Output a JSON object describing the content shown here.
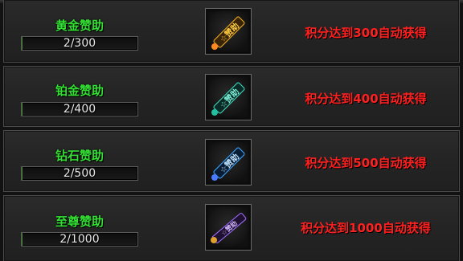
{
  "sponsor_tiers": [
    {
      "name": "黄金赞助",
      "progress_text": "2/300",
      "progress_fraction": 0.0067,
      "condition": "积分达到300自动获得",
      "badge_icon": "gold-title-badge-icon",
      "badge_color": "#f0b020"
    },
    {
      "name": "铂金赞助",
      "progress_text": "2/400",
      "progress_fraction": 0.005,
      "condition": "积分达到400自动获得",
      "badge_icon": "platinum-title-badge-icon",
      "badge_color": "#40e0c0"
    },
    {
      "name": "钻石赞助",
      "progress_text": "2/500",
      "progress_fraction": 0.004,
      "condition": "积分达到500自动获得",
      "badge_icon": "diamond-title-badge-icon",
      "badge_color": "#40a8ff"
    },
    {
      "name": "至尊赞助",
      "progress_text": "2/1000",
      "progress_fraction": 0.002,
      "condition": "积分达到1000自动获得",
      "badge_icon": "supreme-title-badge-icon",
      "badge_color": "#a070ff"
    }
  ]
}
